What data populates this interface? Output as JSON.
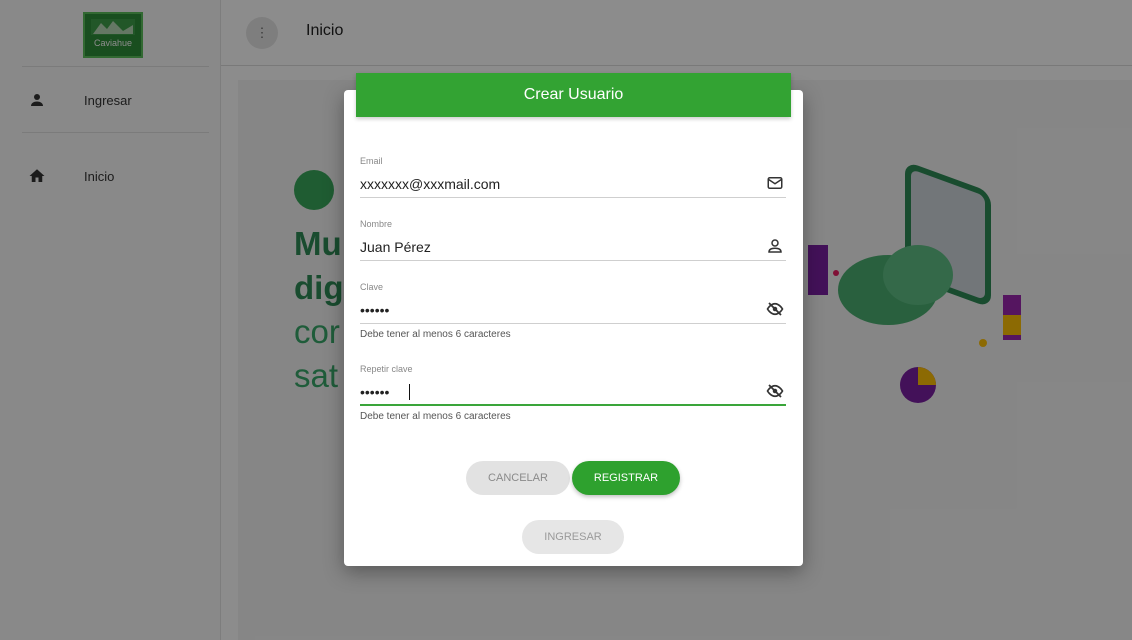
{
  "sidebar": {
    "logo_text": "Caviahue",
    "items": [
      {
        "label": "Ingresar",
        "icon": "person-icon"
      },
      {
        "label": "Inicio",
        "icon": "home-icon"
      }
    ]
  },
  "topbar": {
    "menu_icon": "more-vert-icon",
    "title": "Inicio"
  },
  "hero": {
    "line1": "Mu",
    "line2": "dig",
    "line3": "cor",
    "line4": "sat"
  },
  "modal": {
    "title": "Crear Usuario",
    "fields": {
      "email": {
        "label": "Email",
        "value": "xxxxxxx@xxxmail.com",
        "icon": "mail-icon"
      },
      "nombre": {
        "label": "Nombre",
        "value": "Juan Pérez",
        "icon": "user-outline-icon"
      },
      "clave": {
        "label": "Clave",
        "value": "••••••",
        "icon": "eye-off-icon",
        "hint": "Debe tener al menos 6 caracteres"
      },
      "repetir": {
        "label": "Repetir clave",
        "value": "••••••",
        "icon": "eye-off-icon",
        "hint": "Debe tener al menos 6 caracteres"
      }
    },
    "buttons": {
      "cancel": "CANCELAR",
      "register": "REGISTRAR",
      "login": "INGRESAR"
    }
  },
  "colors": {
    "accent": "#33a333",
    "brand_dark": "#2f8f3a"
  }
}
